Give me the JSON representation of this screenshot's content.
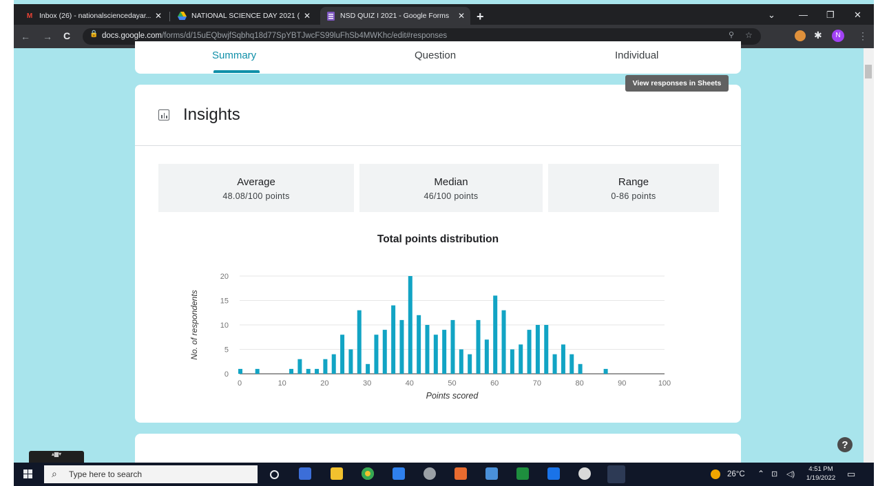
{
  "browser": {
    "tabs": [
      {
        "title": "Inbox (26) - nationalsciencedayar...",
        "icon": "gmail-icon",
        "active": false
      },
      {
        "title": "NATIONAL SCIENCE DAY 2021 (2...",
        "icon": "google-drive-icon",
        "active": false
      },
      {
        "title": "NSD QUIZ I 2021 - Google Forms",
        "icon": "google-forms-icon",
        "active": true
      }
    ],
    "url_host": "docs.google.com",
    "url_path": "/forms/d/15uEQbwjfSqbhq18d77SpYBTJwcFS99luFhSb4MWKhc/edit#responses",
    "profile_initial": "N"
  },
  "form": {
    "tabs": [
      "Summary",
      "Question",
      "Individual"
    ],
    "active_tab": "Summary",
    "tooltip": "View responses in Sheets"
  },
  "insights": {
    "title": "Insights",
    "stats": [
      {
        "label": "Average",
        "value": "48.08/100 points"
      },
      {
        "label": "Median",
        "value": "46/100 points"
      },
      {
        "label": "Range",
        "value": "0-86 points"
      }
    ]
  },
  "chart_data": {
    "type": "bar",
    "title": "Total points distribution",
    "xlabel": "Points scored",
    "ylabel": "No. of respondents",
    "xlim": [
      0,
      100
    ],
    "ylim": [
      0,
      20
    ],
    "xticks": [
      0,
      10,
      20,
      30,
      40,
      50,
      60,
      70,
      80,
      90,
      100
    ],
    "yticks": [
      0,
      5,
      10,
      15,
      20
    ],
    "grid": true,
    "color": "#12a4c4",
    "x": [
      0,
      4,
      12,
      14,
      16,
      18,
      20,
      22,
      24,
      26,
      28,
      30,
      32,
      34,
      36,
      38,
      40,
      42,
      44,
      46,
      48,
      50,
      52,
      54,
      56,
      58,
      60,
      62,
      64,
      66,
      68,
      70,
      72,
      74,
      76,
      78,
      80,
      86
    ],
    "values": [
      1,
      1,
      1,
      3,
      1,
      1,
      3,
      4,
      8,
      5,
      13,
      2,
      8,
      9,
      14,
      11,
      20,
      12,
      10,
      8,
      9,
      11,
      5,
      4,
      11,
      7,
      16,
      13,
      5,
      6,
      9,
      10,
      10,
      4,
      6,
      4,
      2,
      1
    ]
  },
  "taskbar": {
    "search_placeholder": "Type here to search",
    "weather": "26°C",
    "time": "4:51 PM",
    "date": "1/19/2022"
  }
}
